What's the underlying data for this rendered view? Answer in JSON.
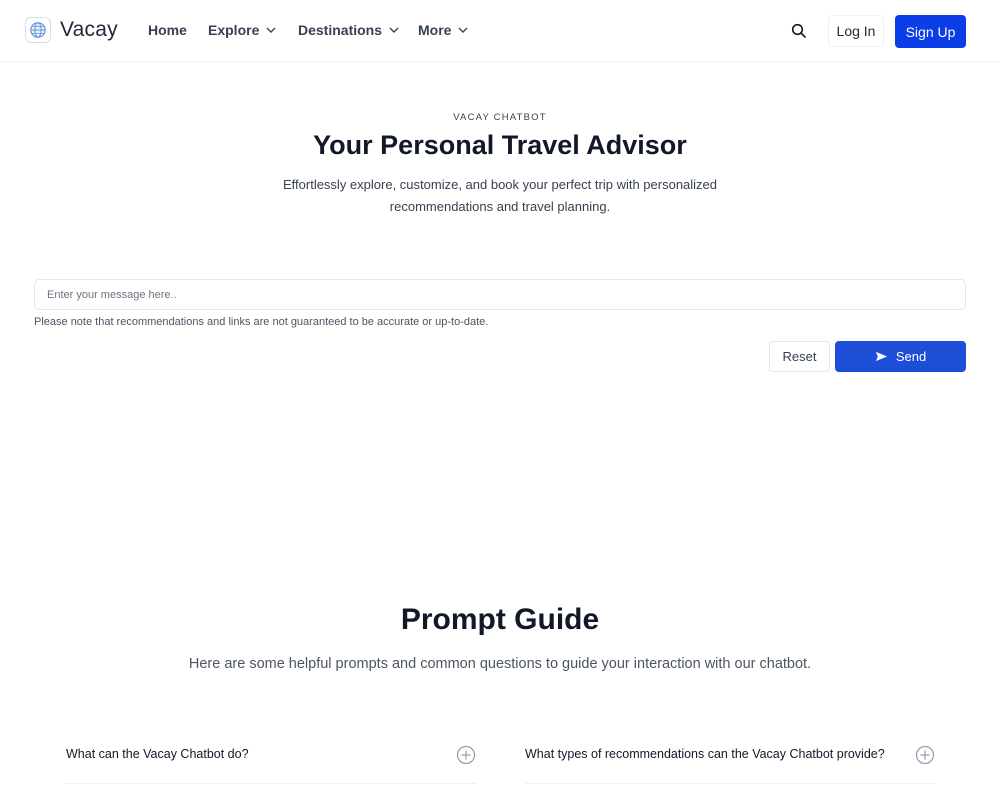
{
  "nav": {
    "brand": "Vacay",
    "items": [
      {
        "label": "Home"
      },
      {
        "label": "Explore"
      },
      {
        "label": "Destinations"
      },
      {
        "label": "More"
      }
    ],
    "login_label": "Log In",
    "signup_label": "Sign Up"
  },
  "hero": {
    "eyebrow": "VACAY CHATBOT",
    "title": "Your Personal Travel Advisor",
    "subtitle": "Effortlessly explore, customize, and book your perfect trip with personalized recommendations and travel planning."
  },
  "chat": {
    "placeholder": "Enter your message here..",
    "note": "Please note that recommendations and links are not guaranteed to be accurate or up-to-date.",
    "reset_label": "Reset",
    "send_label": "Send"
  },
  "guide": {
    "title": "Prompt Guide",
    "subtitle": "Here are some helpful prompts and common questions to guide your interaction with our chatbot.",
    "faqs": [
      {
        "question": "What can the Vacay Chatbot do?"
      },
      {
        "question": "What types of recommendations can the Vacay Chatbot provide?"
      }
    ]
  },
  "colors": {
    "primary": "#0b3ee6",
    "send": "#1d4ed8",
    "text": "#111827"
  }
}
